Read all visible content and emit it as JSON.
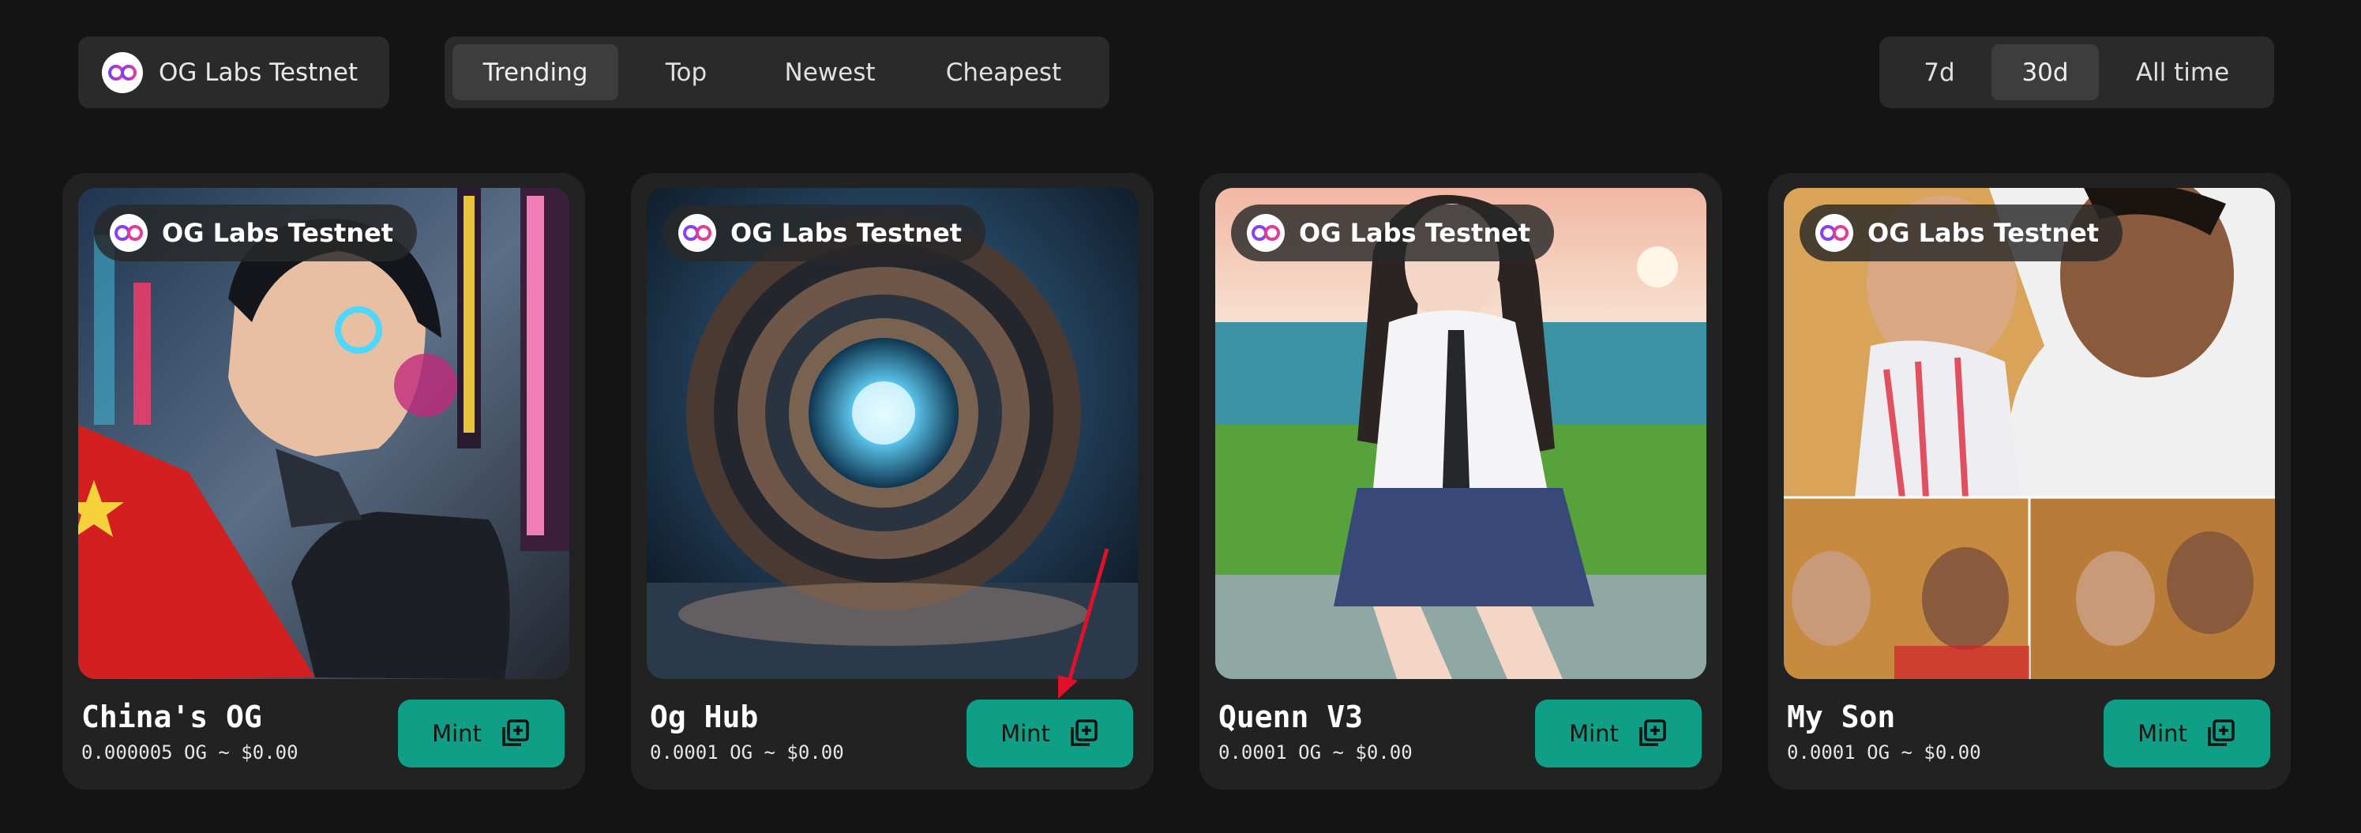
{
  "network": {
    "label": "OG Labs Testnet",
    "icon": "og-logo-icon"
  },
  "sort_tabs": [
    {
      "label": "Trending",
      "active": true
    },
    {
      "label": "Top",
      "active": false
    },
    {
      "label": "Newest",
      "active": false
    },
    {
      "label": "Cheapest",
      "active": false
    }
  ],
  "time_tabs": [
    {
      "label": "7d",
      "active": false
    },
    {
      "label": "30d",
      "active": true
    },
    {
      "label": "All time",
      "active": false
    }
  ],
  "cards": [
    {
      "chip": "OG Labs Testnet",
      "title": "China's OG",
      "price": "0.000005 OG ~ $0.00",
      "mint_label": "Mint",
      "image": "cyberpunk-woman-image"
    },
    {
      "chip": "OG Labs Testnet",
      "title": "Og Hub",
      "price": "0.0001 OG ~ $0.00",
      "mint_label": "Mint",
      "image": "sci-fi-portal-image"
    },
    {
      "chip": "OG Labs Testnet",
      "title": "Quenn V3",
      "price": "0.0001 OG ~ $0.00",
      "mint_label": "Mint",
      "image": "anime-girl-seaside-image"
    },
    {
      "chip": "OG Labs Testnet",
      "title": "My Son",
      "price": "0.0001 OG ~ $0.00",
      "mint_label": "Mint",
      "image": "family-photo-collage-image"
    }
  ],
  "colors": {
    "background": "#141414",
    "panel": "#2a2a2a",
    "card": "#222222",
    "mint_button": "#0f9f86",
    "annotation_arrow": "#e0102a"
  }
}
